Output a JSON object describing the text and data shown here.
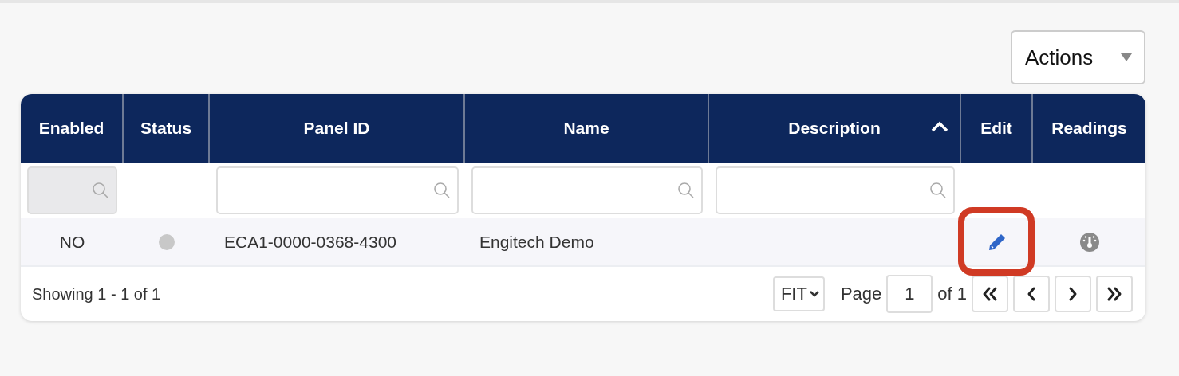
{
  "actions_button": {
    "label": "Actions"
  },
  "table": {
    "columns": [
      {
        "label": "Enabled",
        "sorted": false,
        "filter": {
          "disabled": true
        }
      },
      {
        "label": "Status",
        "sorted": false
      },
      {
        "label": "Panel ID",
        "sorted": false,
        "filter": {
          "disabled": false
        }
      },
      {
        "label": "Name",
        "sorted": false,
        "filter": {
          "disabled": false
        }
      },
      {
        "label": "Description",
        "sorted": true,
        "filter": {
          "disabled": false
        }
      },
      {
        "label": "Edit",
        "sorted": false
      },
      {
        "label": "Readings",
        "sorted": false
      }
    ],
    "rows": [
      {
        "enabled": "NO",
        "color": "#c8c8c8",
        "panel_id": "ECA1-0000-0368-4300",
        "name": "Engitech Demo",
        "edit_highlighted": true
      }
    ]
  },
  "footer": {
    "showing": "Showing 1 - 1 of 1",
    "page_size": "FIT",
    "page_label": "Page",
    "page": "1",
    "of_pages": "of 1"
  }
}
